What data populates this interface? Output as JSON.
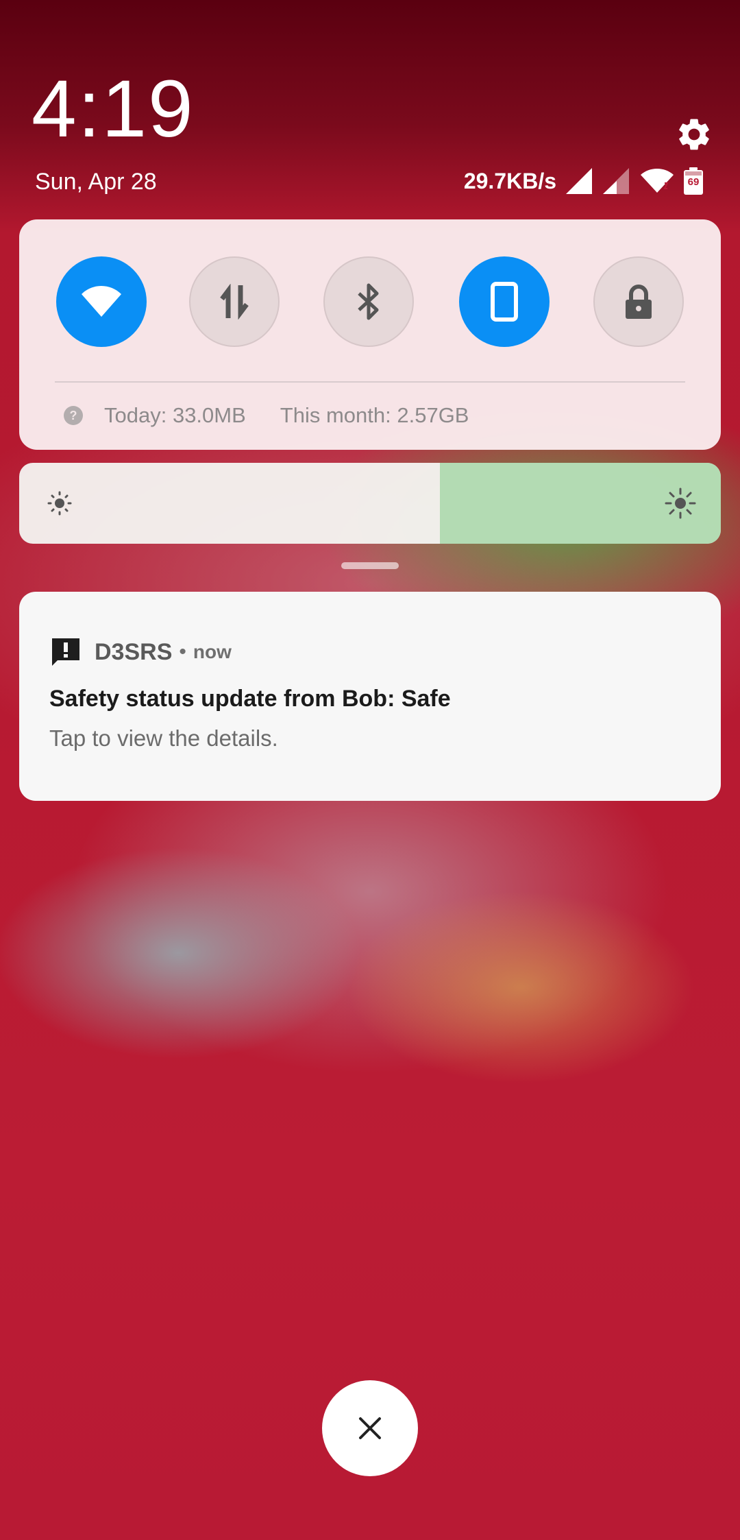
{
  "clock": {
    "time": "4:19",
    "date": "Sun, Apr 28"
  },
  "status_bar": {
    "net_speed": "29.7KB/s",
    "battery_level": "69",
    "icons": [
      "signal-1-icon",
      "signal-2-icon",
      "wifi-icon",
      "battery-icon"
    ]
  },
  "quick_settings": {
    "toggles": [
      {
        "name": "wifi",
        "icon": "wifi-icon",
        "state": "on"
      },
      {
        "name": "mobile-data",
        "icon": "mobile-data-icon",
        "state": "off"
      },
      {
        "name": "bluetooth",
        "icon": "bluetooth-icon",
        "state": "off"
      },
      {
        "name": "screen",
        "icon": "phone-icon",
        "state": "on"
      },
      {
        "name": "lock",
        "icon": "lock-icon",
        "state": "off"
      }
    ],
    "usage_today": "Today: 33.0MB",
    "usage_month": "This month: 2.57GB"
  },
  "brightness": {
    "level": 0.4
  },
  "notification": {
    "app_name": "D3SRS",
    "separator": "•",
    "time": "now",
    "title": "Safety status update from Bob: Safe",
    "text": "Tap to view the details."
  },
  "colors": {
    "accent": "#0a8ff5",
    "background": "#b81a34",
    "brightness_fill": "#b0dab0"
  }
}
